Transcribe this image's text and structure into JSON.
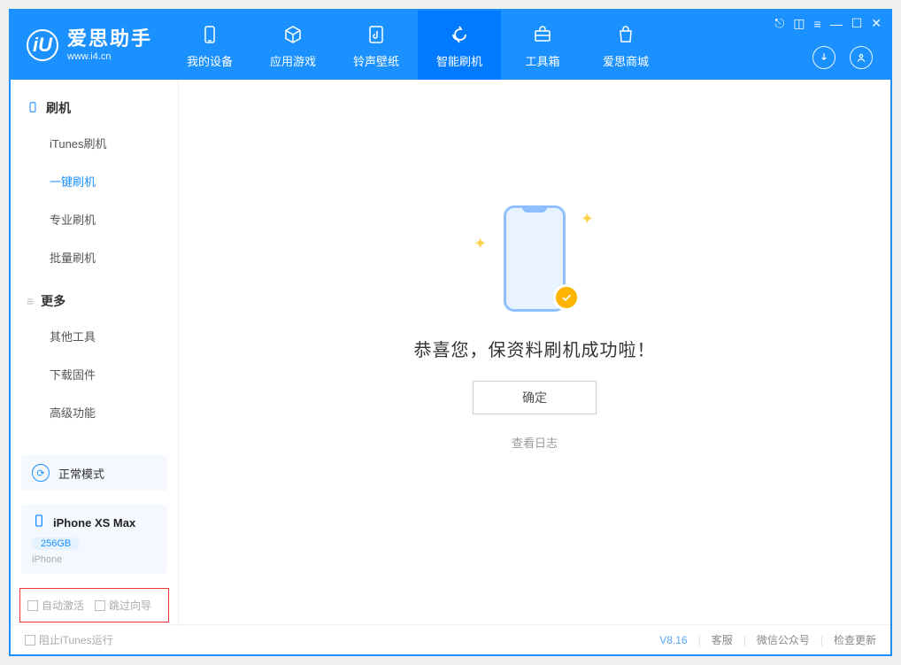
{
  "app": {
    "title": "爱思助手",
    "subtitle": "www.i4.cn",
    "version": "V8.16"
  },
  "nav": {
    "items": [
      {
        "label": "我的设备"
      },
      {
        "label": "应用游戏"
      },
      {
        "label": "铃声壁纸"
      },
      {
        "label": "智能刷机"
      },
      {
        "label": "工具箱"
      },
      {
        "label": "爱思商城"
      }
    ]
  },
  "sidebar": {
    "section1": {
      "title": "刷机",
      "items": [
        {
          "label": "iTunes刷机"
        },
        {
          "label": "一键刷机"
        },
        {
          "label": "专业刷机"
        },
        {
          "label": "批量刷机"
        }
      ]
    },
    "section2": {
      "title": "更多",
      "items": [
        {
          "label": "其他工具"
        },
        {
          "label": "下载固件"
        },
        {
          "label": "高级功能"
        }
      ]
    },
    "mode": "正常模式",
    "device": {
      "name": "iPhone XS Max",
      "capacity": "256GB",
      "type": "iPhone"
    },
    "redbox": {
      "chk1": "自动激活",
      "chk2": "跳过向导"
    }
  },
  "main": {
    "title": "恭喜您，保资料刷机成功啦！",
    "ok": "确定",
    "log": "查看日志"
  },
  "footer": {
    "block_itunes": "阻止iTunes运行",
    "links": {
      "cs": "客服",
      "wechat": "微信公众号",
      "update": "检查更新"
    }
  }
}
